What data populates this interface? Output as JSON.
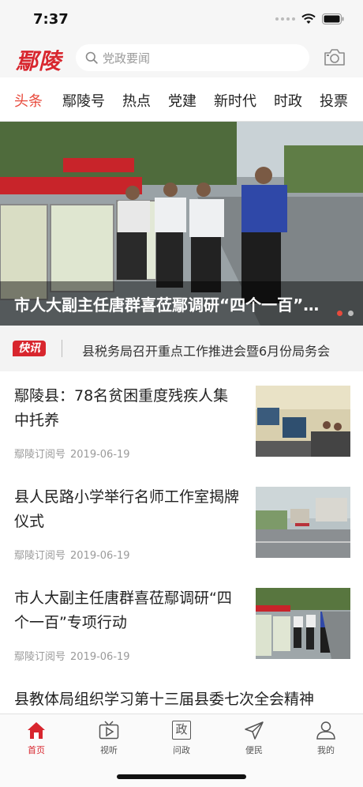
{
  "status_bar": {
    "time": "7:37"
  },
  "header": {
    "logo_text": "鄢陵",
    "search_placeholder": "党政要闻",
    "search_icon": "search-icon",
    "camera_icon": "camera-icon"
  },
  "tabs": [
    {
      "label": "头条",
      "active": true
    },
    {
      "label": "鄢陵号",
      "active": false
    },
    {
      "label": "热点",
      "active": false
    },
    {
      "label": "党建",
      "active": false
    },
    {
      "label": "新时代",
      "active": false
    },
    {
      "label": "时政",
      "active": false
    },
    {
      "label": "投票",
      "active": false
    }
  ],
  "banner": {
    "title": "市人大副主任唐群喜莅鄢调研“四个一百”专项行动",
    "slide_index": 1,
    "slide_count": 2
  },
  "flash": {
    "badge": "快讯",
    "text": "县税务局召开重点工作推进会暨6月份局务会"
  },
  "news": [
    {
      "title": "鄢陵县：78名贫困重度残疾人集中托养",
      "source": "鄢陵订阅号",
      "date": "2019-06-19"
    },
    {
      "title": "县人民路小学举行名师工作室揭牌仪式",
      "source": "鄢陵订阅号",
      "date": "2019-06-19"
    },
    {
      "title": "市人大副主任唐群喜莅鄢调研“四个一百”专项行动",
      "source": "鄢陵订阅号",
      "date": "2019-06-19"
    },
    {
      "title": "县教体局组织学习第十三届县委七次全会精神"
    }
  ],
  "tabbar": [
    {
      "label": "首页",
      "icon": "home-icon",
      "active": true
    },
    {
      "label": "视听",
      "icon": "tv-icon",
      "active": false
    },
    {
      "label": "问政",
      "icon": "politics-icon",
      "icon_text": "政",
      "active": false
    },
    {
      "label": "便民",
      "icon": "send-icon",
      "active": false
    },
    {
      "label": "我的",
      "icon": "user-icon",
      "active": false
    }
  ],
  "colors": {
    "accent": "#d8262e",
    "tab_active": "#e84a3c"
  }
}
